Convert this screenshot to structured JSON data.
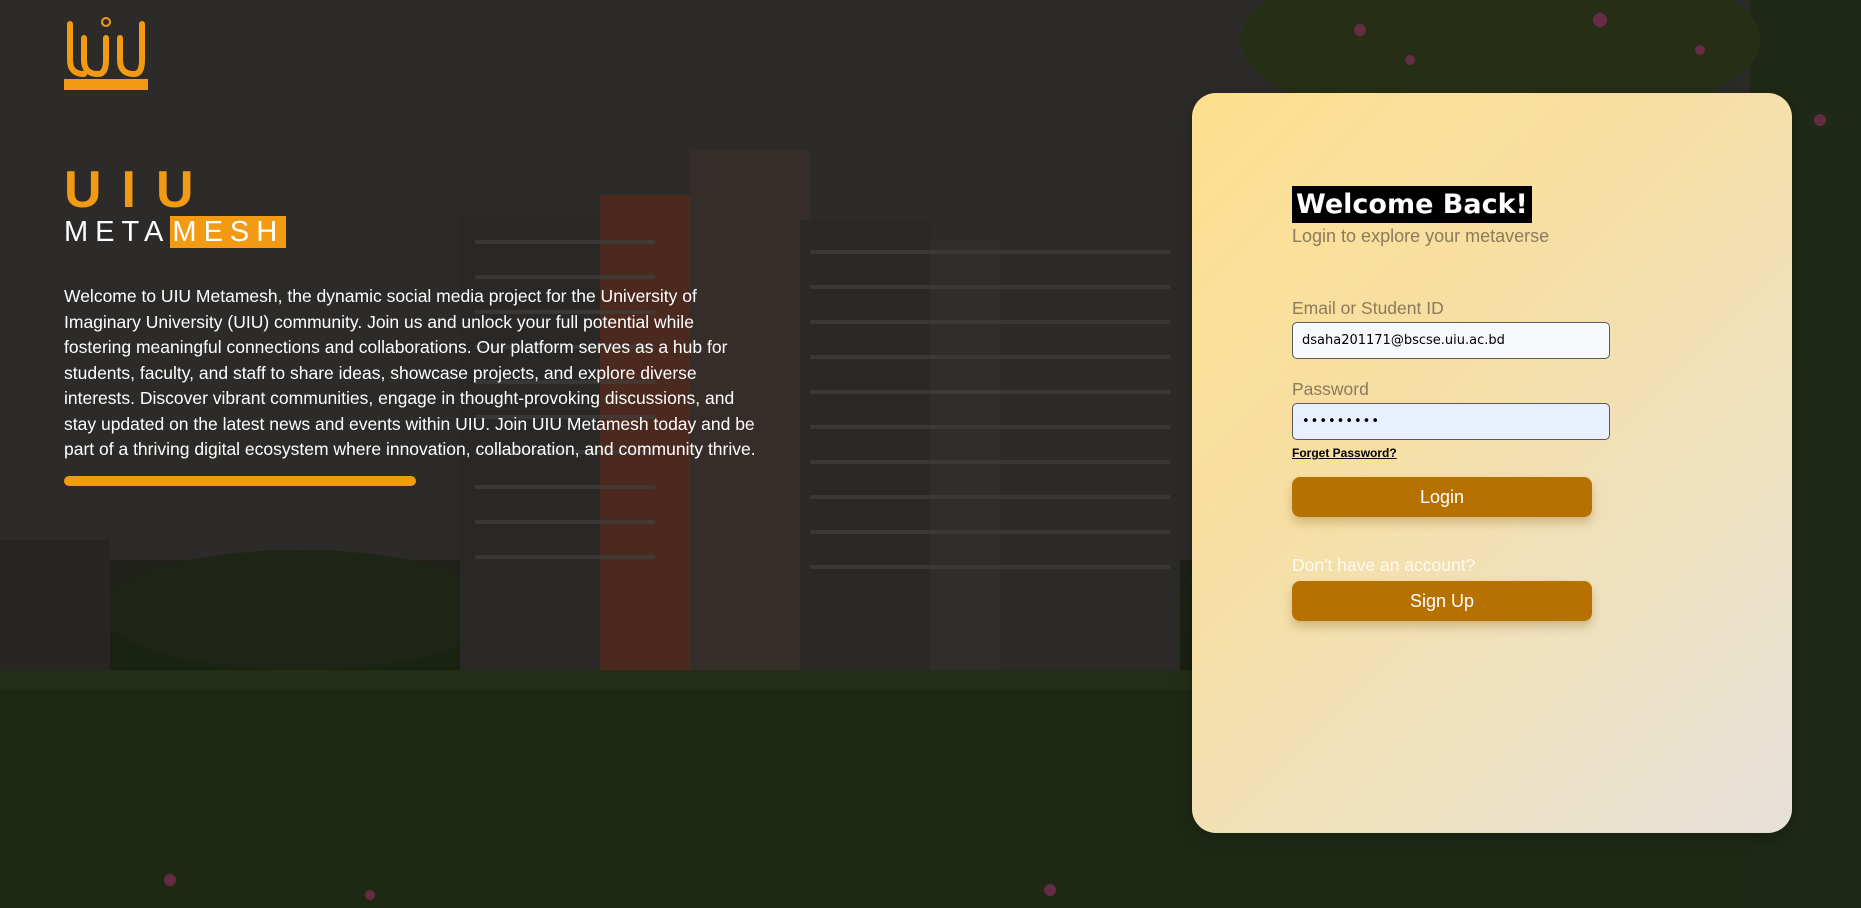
{
  "brand": {
    "logo_text": "Meta Mesh",
    "title_top": "UIU",
    "title_bottom_plain": "META",
    "title_bottom_highlight": "MESH",
    "intro": "Welcome to UIU Metamesh, the dynamic social media project for the University of Imaginary University (UIU) community. Join us and unlock your full potential while fostering meaningful connections and collaborations. Our platform serves as a hub for students, faculty, and staff to share ideas, showcase projects, and explore diverse interests. Discover vibrant communities, engage in thought-provoking discussions, and stay updated on the latest news and events within UIU. Join UIU Metamesh today and be part of a thriving digital ecosystem where innovation, collaboration, and community thrive."
  },
  "login": {
    "heading": "Welcome Back!",
    "subtitle": "Login to explore your metaverse",
    "email_label": "Email or Student ID",
    "email_value": "dsaha201171@bscse.uiu.ac.bd",
    "password_label": "Password",
    "password_value": "•••••••••",
    "forget_label": "Forget Password?",
    "login_button": "Login",
    "no_account_text": "Don't have an account?",
    "signup_button": "Sign Up"
  },
  "colors": {
    "accent": "#f29a12",
    "button": "#b67100",
    "heading_bg": "#000000"
  },
  "icons": {
    "logo": "uiu-metamesh-logo-icon"
  }
}
